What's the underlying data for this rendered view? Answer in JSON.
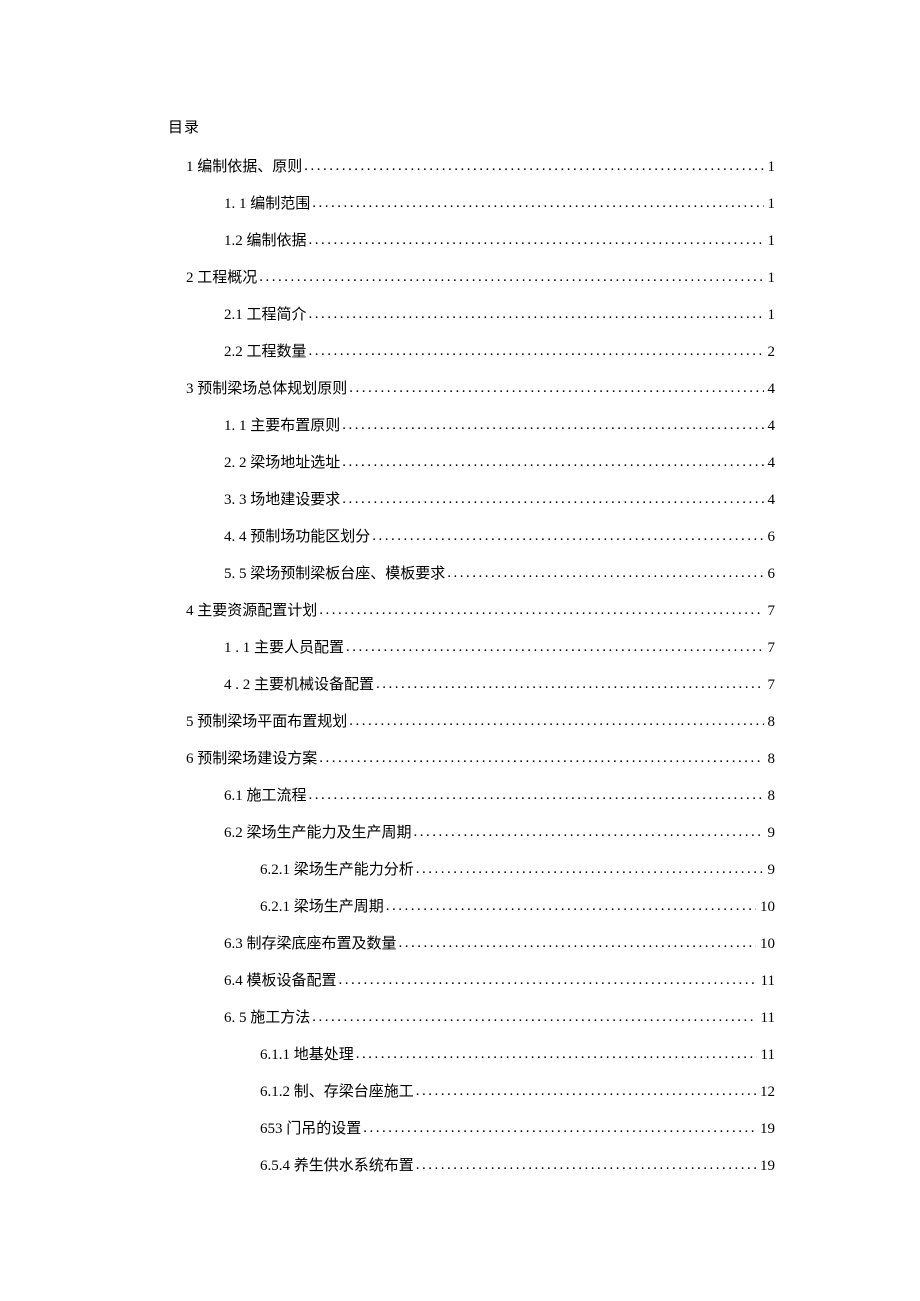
{
  "title": "目录",
  "toc": [
    {
      "level": 1,
      "text": "1 编制依据、原则",
      "page": "1"
    },
    {
      "level": 2,
      "text": "1. 1 编制范围",
      "page": "1"
    },
    {
      "level": 2,
      "text": "1.2 编制依据",
      "page": "1"
    },
    {
      "level": 1,
      "text": "2 工程概况",
      "page": "1"
    },
    {
      "level": 2,
      "text": "2.1  工程简介",
      "page": "1"
    },
    {
      "level": 2,
      "text": "2.2  工程数量",
      "page": "2"
    },
    {
      "level": 1,
      "text": "3 预制梁场总体规划原则",
      "page": "4"
    },
    {
      "level": 2,
      "text": "1. 1 主要布置原则",
      "page": "4"
    },
    {
      "level": 2,
      "text": "2. 2 梁场地址选址",
      "page": "4"
    },
    {
      "level": 2,
      "text": "3. 3 场地建设要求",
      "page": "4"
    },
    {
      "level": 2,
      "text": "4. 4 预制场功能区划分",
      "page": "6"
    },
    {
      "level": 2,
      "text": "5. 5 梁场预制梁板台座、模板要求",
      "page": "6"
    },
    {
      "level": 1,
      "text": "4 主要资源配置计划",
      "page": "7"
    },
    {
      "level": 2,
      "text": "1 . 1 主要人员配置",
      "page": "7"
    },
    {
      "level": 2,
      "text": "4 . 2 主要机械设备配置",
      "page": "7"
    },
    {
      "level": 1,
      "text": "5 预制梁场平面布置规划",
      "page": "8"
    },
    {
      "level": 1,
      "text": "6 预制梁场建设方案",
      "page": "8"
    },
    {
      "level": 2,
      "text": "6.1 施工流程",
      "page": "8"
    },
    {
      "level": 2,
      "text": "6.2 梁场生产能力及生产周期",
      "page": "9"
    },
    {
      "level": 3,
      "text": "6.2.1 梁场生产能力分析",
      "page": "9"
    },
    {
      "level": 3,
      "text": "6.2.1 梁场生产周期",
      "page": "10"
    },
    {
      "level": 2,
      "text": "6.3 制存梁底座布置及数量",
      "page": "10"
    },
    {
      "level": 2,
      "text": "6.4 模板设备配置",
      "page": "11"
    },
    {
      "level": 2,
      "text": "6. 5 施工方法",
      "page": "11"
    },
    {
      "level": 3,
      "text": "6.1.1 地基处理",
      "page": "11"
    },
    {
      "level": 3,
      "text": "6.1.2 制、存梁台座施工",
      "page": "12"
    },
    {
      "level": 3,
      "text": "653 门吊的设置",
      "page": "19"
    },
    {
      "level": 3,
      "text": "6.5.4 养生供水系统布置",
      "page": "19"
    }
  ]
}
